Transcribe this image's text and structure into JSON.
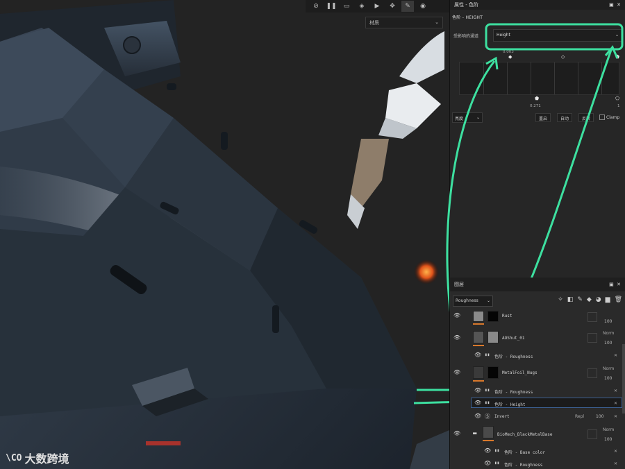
{
  "viewport": {
    "material_select": "材质",
    "logo_text": "大数跨境",
    "logo_mark": "\\CO"
  },
  "properties": {
    "title": "属性 - 色阶",
    "section_title": "色阶 - HEIGHT",
    "channel_label": "受影响的通道",
    "channel_value": "Height",
    "marker_top_left": "0.003",
    "marker_mid_value": "0.271",
    "marker_right_value": "1",
    "mode_select": "亮度",
    "btn_reset": "重启",
    "btn_auto": "自动",
    "btn_invert": "反转",
    "clamp_label": "Clamp"
  },
  "layers": {
    "title": "图层",
    "channel_select": "Roughness",
    "rows": [
      {
        "name": "Rust",
        "blend": "",
        "opacity": "100"
      },
      {
        "name": "AOShut_01",
        "blend": "Norm",
        "opacity": "100"
      },
      {
        "name": "色阶 - Roughness",
        "blend": "",
        "opacity": ""
      },
      {
        "name": "MetalFoil_Nugs",
        "blend": "Norm",
        "opacity": "100"
      },
      {
        "name": "色阶 - Roughness",
        "blend": "",
        "opacity": ""
      },
      {
        "name": "色阶 - Height",
        "blend": "",
        "opacity": ""
      },
      {
        "name": "Invert",
        "blend": "Repl",
        "opacity": "100"
      },
      {
        "name": "BioMech_BlackMetalBase",
        "blend": "Norm",
        "opacity": "100"
      },
      {
        "name": "色阶 - Base color",
        "blend": "",
        "opacity": ""
      },
      {
        "name": "色阶 - Roughness",
        "blend": "",
        "opacity": ""
      }
    ]
  },
  "colors": {
    "annotation_green": "#3de0a0",
    "accent_orange": "#d9782b"
  }
}
